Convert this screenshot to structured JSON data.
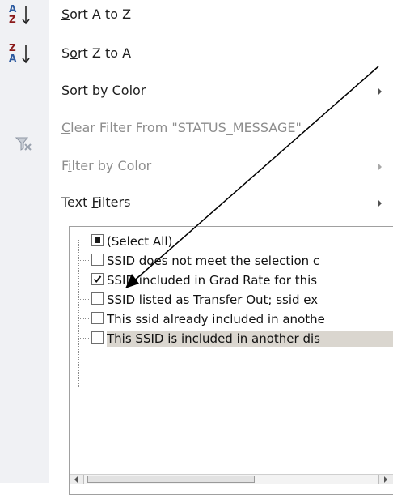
{
  "menu": {
    "sort_a_to_z": {
      "key": "S",
      "rest": "ort A to Z",
      "icon": "sort-ascending-icon"
    },
    "sort_z_to_a": {
      "pre": "S",
      "key": "o",
      "rest": "rt Z to A",
      "icon": "sort-descending-icon"
    },
    "sort_by_color": {
      "pre": "Sor",
      "key": "t",
      "rest": " by Color"
    },
    "clear_filter": {
      "key": "C",
      "rest": "lear Filter From \"STATUS_MESSAGE\"",
      "icon": "clear-filter-icon"
    },
    "filter_by_color": {
      "pre": "F",
      "key": "i",
      "rest": "lter by Color"
    },
    "text_filters": {
      "pre": "Text ",
      "key": "F",
      "rest": "ilters"
    }
  },
  "list": {
    "items": [
      {
        "label": "(Select All)",
        "state": "partial"
      },
      {
        "label": "SSID does not meet the selection c",
        "state": "unchecked"
      },
      {
        "label": "SSID included in Grad Rate for this",
        "state": "checked"
      },
      {
        "label": "SSID listed as Transfer Out; ssid ex",
        "state": "unchecked"
      },
      {
        "label": "This ssid already included in anothe",
        "state": "unchecked"
      },
      {
        "label": "This SSID is included in another dis",
        "state": "unchecked"
      }
    ]
  },
  "colors": {
    "gutter": "#f0f1f4",
    "text": "#1f1f1f",
    "disabled_text": "#8d8d8d",
    "selected_row": "#dad6cf",
    "annotation_arrow": "#000000"
  }
}
